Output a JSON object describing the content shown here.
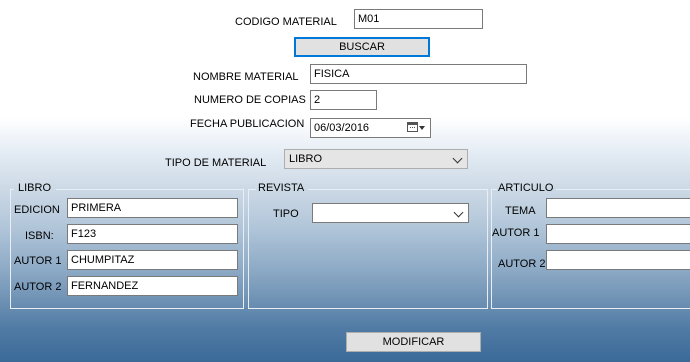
{
  "search": {
    "codigo_label": "CODIGO MATERIAL",
    "codigo_value": "M01",
    "buscar_label": "BUSCAR"
  },
  "general": {
    "nombre_label": "NOMBRE MATERIAL",
    "nombre_value": "FISICA",
    "copias_label": "NUMERO DE COPIAS",
    "copias_value": "2",
    "fecha_label": "FECHA PUBLICACION",
    "fecha_value": "06/03/2016",
    "tipo_label": "TIPO DE MATERIAL",
    "tipo_value": "LIBRO"
  },
  "libro": {
    "title": "LIBRO",
    "edicion_label": "EDICION",
    "edicion_value": "PRIMERA",
    "isbn_label": "ISBN:",
    "isbn_value": "F123",
    "autor1_label": "AUTOR 1",
    "autor1_value": "CHUMPITAZ",
    "autor2_label": "AUTOR 2",
    "autor2_value": "FERNANDEZ"
  },
  "revista": {
    "title": "REVISTA",
    "tipo_label": "TIPO",
    "tipo_value": ""
  },
  "articulo": {
    "title": "ARTICULO",
    "tema_label": "TEMA",
    "tema_value": "",
    "autor1_label": "AUTOR 1",
    "autor1_value": "",
    "autor2_label": "AUTOR 2",
    "autor2_value": ""
  },
  "actions": {
    "modificar_label": "MODIFICAR"
  }
}
